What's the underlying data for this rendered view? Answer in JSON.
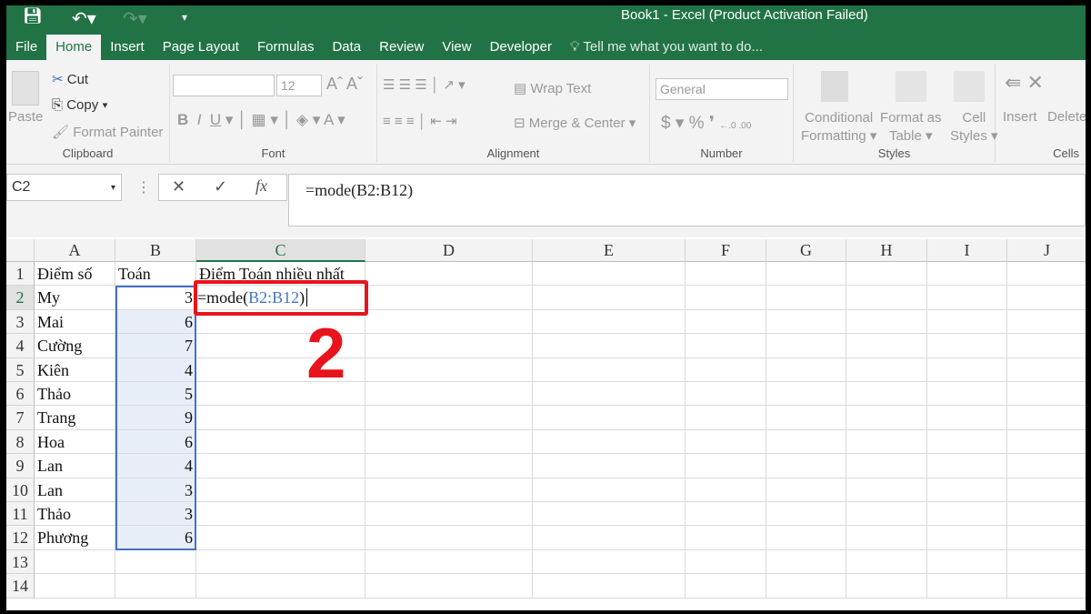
{
  "window": {
    "title": "Book1 - Excel (Product Activation Failed)"
  },
  "tabs": [
    "File",
    "Home",
    "Insert",
    "Page Layout",
    "Formulas",
    "Data",
    "Review",
    "View",
    "Developer"
  ],
  "tell_me": "Tell me what you want to do...",
  "ribbon": {
    "clipboard": {
      "paste": "Paste",
      "cut": "Cut",
      "copy": "Copy",
      "format_painter": "Format Painter",
      "label": "Clipboard"
    },
    "font": {
      "size": "12",
      "label": "Font"
    },
    "alignment": {
      "wrap": "Wrap Text",
      "merge": "Merge & Center",
      "label": "Alignment"
    },
    "number": {
      "format": "General",
      "label": "Number"
    },
    "styles": {
      "cond1": "Conditional",
      "cond2": "Formatting",
      "fmt1": "Format as",
      "fmt2": "Table",
      "cell1": "Cell",
      "cell2": "Styles",
      "label": "Styles"
    },
    "cells": {
      "insert": "Insert",
      "delete": "Delete",
      "label": "Cells"
    }
  },
  "name_box": "C2",
  "formula": "=mode(B2:B12)",
  "columns": [
    "A",
    "B",
    "C",
    "D",
    "E",
    "F",
    "G",
    "H",
    "I",
    "J"
  ],
  "rows": [
    "1",
    "2",
    "3",
    "4",
    "5",
    "6",
    "7",
    "8",
    "9",
    "10",
    "11",
    "12",
    "13",
    "14"
  ],
  "header_row": {
    "a": "Điểm số",
    "b": "Toán",
    "c": "Điểm Toán nhiều nhất"
  },
  "data": [
    {
      "name": "My",
      "score": "3"
    },
    {
      "name": "Mai",
      "score": "6"
    },
    {
      "name": "Cường",
      "score": "7"
    },
    {
      "name": "Kiên",
      "score": "4"
    },
    {
      "name": "Thảo",
      "score": "5"
    },
    {
      "name": "Trang",
      "score": "9"
    },
    {
      "name": "Hoa",
      "score": "6"
    },
    {
      "name": "Lan",
      "score": "4"
    },
    {
      "name": "Lan",
      "score": "3"
    },
    {
      "name": "Thảo",
      "score": "3"
    },
    {
      "name": "Phương",
      "score": "6"
    }
  ],
  "edit_cell": {
    "prefix": "=mode(",
    "ref": "B2:B12",
    "suffix": ")"
  },
  "annotation": "2",
  "colors": {
    "green": "#217346",
    "ref_blue": "#4472c4",
    "highlight_red": "#e8141b"
  }
}
